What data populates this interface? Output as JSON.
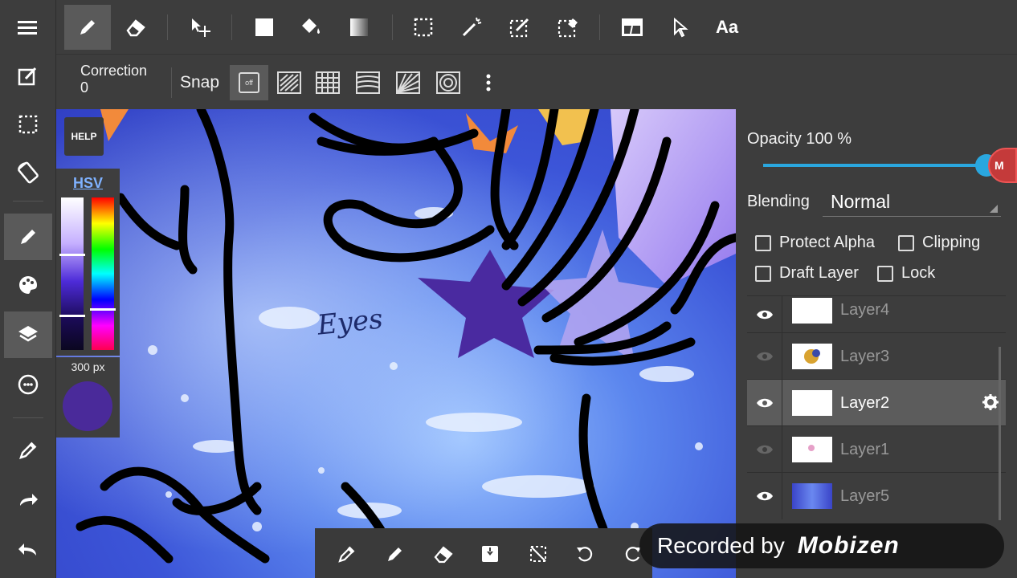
{
  "top_toolbar": {
    "tools": [
      "pen",
      "eraser",
      "move",
      "fill-rect",
      "bucket",
      "gradient",
      "select-rect",
      "magic-wand",
      "select-pen",
      "select-eraser",
      "frame",
      "pointer",
      "text"
    ],
    "text_tool_label": "Aa"
  },
  "sub_toolbar": {
    "correction_label": "Correction",
    "correction_value": "0",
    "snap_label": "Snap",
    "snap_off_label": "off"
  },
  "color_panel": {
    "help_label": "HELP",
    "mode_tab": "HSV",
    "brush_size": "300 px",
    "brush_color": "#4a2a9a"
  },
  "canvas": {
    "text_annotation": "Eyes"
  },
  "layer_panel": {
    "opacity_label": "Opacity 100 %",
    "opacity_value": 100,
    "blending_label": "Blending",
    "blending_value": "Normal",
    "checkboxes": {
      "protect_alpha": "Protect Alpha",
      "clipping": "Clipping",
      "draft_layer": "Draft Layer",
      "lock": "Lock"
    },
    "layers": [
      {
        "name": "Layer4",
        "visible": true,
        "selected": false
      },
      {
        "name": "Layer3",
        "visible": false,
        "selected": false
      },
      {
        "name": "Layer2",
        "visible": true,
        "selected": true
      },
      {
        "name": "Layer1",
        "visible": false,
        "selected": false
      },
      {
        "name": "Layer5",
        "visible": true,
        "selected": false
      }
    ]
  },
  "watermark": {
    "recorded_by": "Recorded by",
    "brand": "Mobizen"
  },
  "colors": {
    "accent": "#2aa7df",
    "panel": "#3d3d3d",
    "active": "#5a5a5a"
  }
}
